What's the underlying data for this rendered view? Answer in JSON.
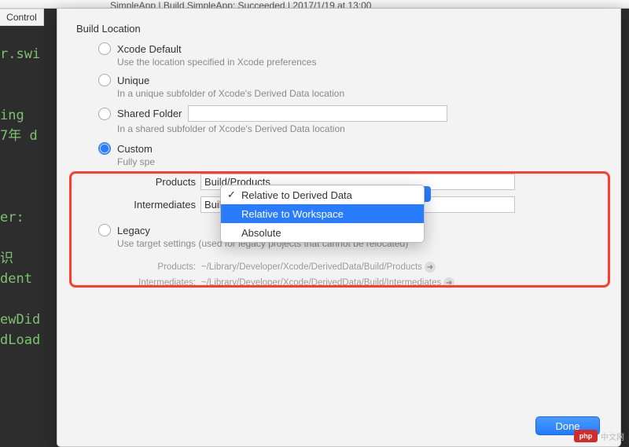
{
  "topbar": {
    "text": "SimpleApp  |  Build SimpleApp:  Succeeded  |  2017/1/19 at 13:00"
  },
  "sidebar_tab": "Control",
  "code_bg_lines": [
    "",
    "r.swi",
    "",
    "",
    "ing  ",
    "7年 d",
    "",
    "",
    "",
    "er:",
    "",
    "识",
    "dent",
    "",
    "ewDid",
    "dLoad"
  ],
  "sheet": {
    "title": "Build Location",
    "options": {
      "xcode_default": {
        "label": "Xcode Default",
        "desc": "Use the location specified in Xcode preferences"
      },
      "unique": {
        "label": "Unique",
        "desc": "In a unique subfolder of Xcode's Derived Data location"
      },
      "shared": {
        "label": "Shared Folder",
        "desc": "In a shared subfolder of Xcode's Derived Data location",
        "value": ""
      },
      "custom": {
        "label": "Custom",
        "desc": "Fully spe",
        "selected_name": "Relative to Derived Data"
      },
      "legacy": {
        "label": "Legacy",
        "desc": "Use target settings (used for legacy projects that cannot be relocated)"
      }
    },
    "custom_fields": {
      "products_label": "Products",
      "products_value": "Build/Products",
      "intermediates_label": "Intermediates",
      "intermediates_value": "Build/Intermediates"
    },
    "paths": {
      "products_key": "Products:",
      "products_val": "~/Library/Developer/Xcode/DerivedData/Build/Products",
      "intermediates_key": "Intermediates:",
      "intermediates_val": "~/Library/Developer/Xcode/DerivedData/Build/Intermediates"
    },
    "done": "Done"
  },
  "dropdown": {
    "items": [
      {
        "label": "Relative to Derived Data",
        "checked": true,
        "selected": false
      },
      {
        "label": "Relative to Workspace",
        "checked": false,
        "selected": true
      },
      {
        "label": "Absolute",
        "checked": false,
        "selected": false
      }
    ]
  },
  "watermark": {
    "badge": "php",
    "text": "中文网"
  }
}
